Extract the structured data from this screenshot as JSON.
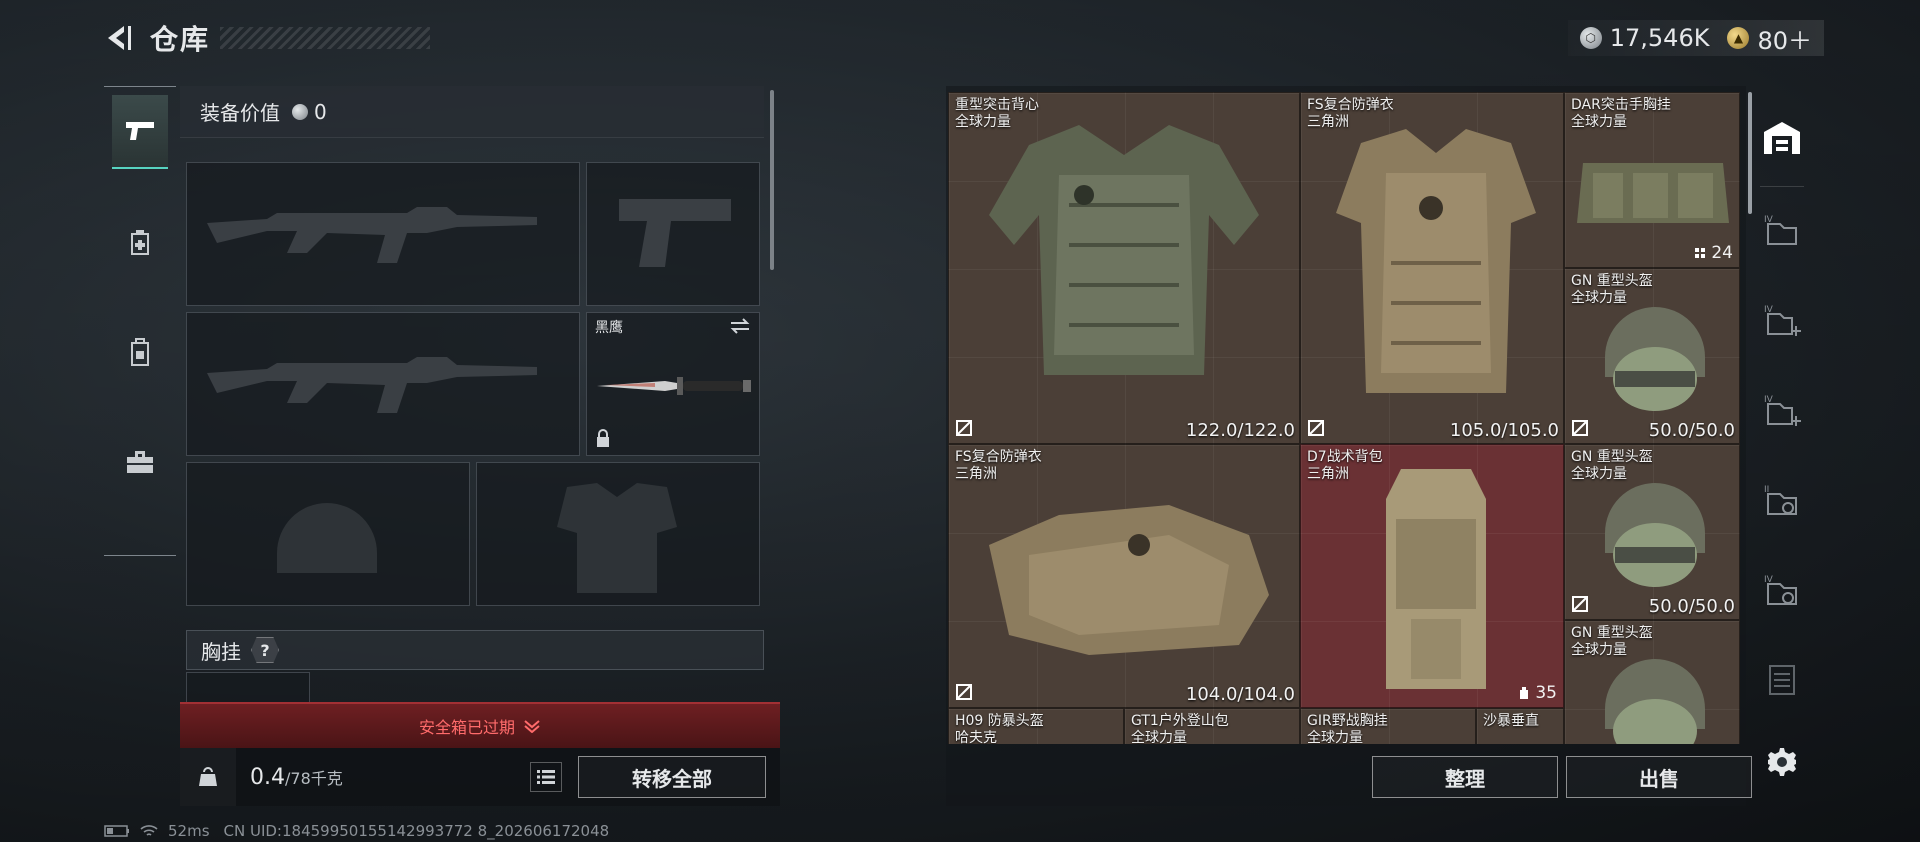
{
  "header": {
    "title": "仓库"
  },
  "currency": {
    "silver": "17,546K",
    "gold": "80＋"
  },
  "left": {
    "equip_value_label": "装备价值",
    "equip_value": "0",
    "melee_name": "黑鹰",
    "chest_label": "胸挂",
    "help": "?",
    "safe_box_expired": "安全箱已过期",
    "weight_value": "0.4",
    "weight_capacity": "/78千克",
    "transfer_all": "转移全部"
  },
  "stash": {
    "items": [
      {
        "name": "重型突击背心",
        "sub": "全球力量",
        "durability": "122.0/122.0"
      },
      {
        "name": "FS复合防弹衣",
        "sub": "三角洲",
        "durability": "105.0/105.0"
      },
      {
        "name": "DAR突击手胸挂",
        "sub": "全球力量",
        "count": "24"
      },
      {
        "name": "GN 重型头盔",
        "sub": "全球力量",
        "durability": "50.0/50.0"
      },
      {
        "name": "FS复合防弹衣",
        "sub": "三角洲",
        "durability": "104.0/104.0"
      },
      {
        "name": "D7战术背包",
        "sub": "三角洲",
        "count": "35"
      },
      {
        "name": "GN 重型头盔",
        "sub": "全球力量",
        "durability": "50.0/50.0"
      },
      {
        "name": "GN 重型头盔",
        "sub": "全球力量"
      },
      {
        "name": "H09 防暴头盔",
        "sub": "哈夫克"
      },
      {
        "name": "GT1户外登山包",
        "sub": "全球力量"
      },
      {
        "name": "GIR野战胸挂",
        "sub": "全球力量"
      },
      {
        "name": "沙暴垂直",
        "sub": ""
      }
    ],
    "sort": "整理",
    "sell": "出售"
  },
  "status": {
    "ping": "52ms",
    "uid": "CN UID:18459950155142993772 8_202606172048"
  },
  "colors": {
    "accent": "#57d3c0",
    "item_bg": "#4b3f37",
    "item_red": "#6a3134",
    "warn": "#ff6b6b"
  }
}
